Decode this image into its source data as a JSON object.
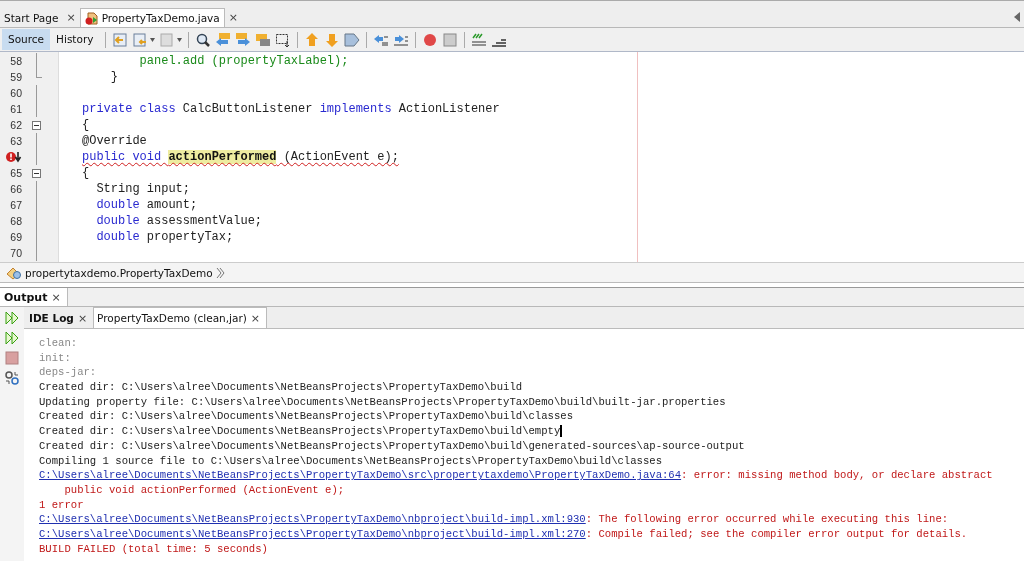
{
  "editor_tabs": [
    {
      "label": "Start Page",
      "close": "×",
      "selected": false
    },
    {
      "label": "PropertyTaxDemo.java",
      "close": "×",
      "selected": true
    }
  ],
  "view_tabs": [
    {
      "label": "Source",
      "selected": true
    },
    {
      "label": "History",
      "selected": false
    }
  ],
  "code_lines": [
    {
      "number": "58",
      "foldable": false,
      "fold_end": false,
      "segments": [
        {
          "text": "        panel.add (propertyTaxLabel);",
          "kind": "field"
        }
      ]
    },
    {
      "number": "59",
      "foldable": false,
      "fold_end": true,
      "segments": [
        {
          "text": "    }",
          "kind": "plain"
        }
      ]
    },
    {
      "number": "60",
      "foldable": false,
      "fold_end": false
    },
    {
      "number": "61",
      "foldable": false,
      "fold_end": false,
      "segments": [
        {
          "text": "private class",
          "kind": "keyword"
        },
        {
          "text": " CalcButtonListener ",
          "kind": "plain"
        },
        {
          "text": "implements",
          "kind": "keyword"
        },
        {
          "text": " ActionListener",
          "kind": "plain"
        }
      ]
    },
    {
      "number": "62",
      "foldable": true,
      "fold_end": false,
      "segments": [
        {
          "text": "{",
          "kind": "plain"
        }
      ]
    },
    {
      "number": "63",
      "foldable": false,
      "fold_end": false,
      "segments": [
        {
          "text": "@Override",
          "kind": "plain"
        }
      ]
    },
    {
      "foldable": false,
      "fold_end": false,
      "error": true,
      "squiggle": true,
      "segments": [
        {
          "text": "public void ",
          "kind": "keyword"
        },
        {
          "text": "actionPerformed",
          "kind": "highlight"
        },
        {
          "text": " (ActionEvent e);",
          "kind": "plain"
        }
      ]
    },
    {
      "number": "65",
      "foldable": true,
      "fold_end": false,
      "segments": [
        {
          "text": "{",
          "kind": "plain"
        }
      ]
    },
    {
      "number": "66",
      "foldable": false,
      "fold_end": false,
      "segments": [
        {
          "text": "  String input;",
          "kind": "plain"
        }
      ]
    },
    {
      "number": "67",
      "foldable": false,
      "fold_end": false,
      "segments": [
        {
          "text": "  double",
          "kind": "keyword"
        },
        {
          "text": " amount;",
          "kind": "plain"
        }
      ]
    },
    {
      "number": "68",
      "foldable": false,
      "fold_end": false,
      "segments": [
        {
          "text": "  double",
          "kind": "keyword"
        },
        {
          "text": " assessmentValue;",
          "kind": "plain"
        }
      ]
    },
    {
      "number": "69",
      "foldable": false,
      "fold_end": false,
      "segments": [
        {
          "text": "  double",
          "kind": "keyword"
        },
        {
          "text": " propertyTax;",
          "kind": "plain"
        }
      ]
    },
    {
      "number": "70",
      "foldable": false,
      "fold_end": false
    }
  ],
  "breadcrumb": "propertytaxdemo.PropertyTaxDemo",
  "output_panel": {
    "title": "Output",
    "close": "×",
    "tabs": [
      {
        "label": "IDE Log",
        "close": "×",
        "selected": false
      },
      {
        "label": "PropertyTaxDemo (clean,jar)",
        "close": "×",
        "selected": true
      }
    ],
    "lines": [
      {
        "segments": [
          {
            "text": "clean:",
            "kind": "grey"
          }
        ]
      },
      {
        "segments": [
          {
            "text": "init:",
            "kind": "grey"
          }
        ]
      },
      {
        "segments": [
          {
            "text": "deps-jar:",
            "kind": "grey"
          }
        ]
      },
      {
        "segments": [
          {
            "text": "Created dir: C:\\Users\\alree\\Documents\\NetBeansProjects\\PropertyTaxDemo\\build",
            "kind": "plain"
          }
        ]
      },
      {
        "segments": [
          {
            "text": "Updating property file: C:\\Users\\alree\\Documents\\NetBeansProjects\\PropertyTaxDemo\\build\\built-jar.properties",
            "kind": "plain"
          }
        ]
      },
      {
        "segments": [
          {
            "text": "Created dir: C:\\Users\\alree\\Documents\\NetBeansProjects\\PropertyTaxDemo\\build\\classes",
            "kind": "plain"
          }
        ]
      },
      {
        "caret": true,
        "segments": [
          {
            "text": "Created dir: C:\\Users\\alree\\Documents\\NetBeansProjects\\PropertyTaxDemo\\build\\empty",
            "kind": "plain"
          }
        ]
      },
      {
        "segments": [
          {
            "text": "Created dir: C:\\Users\\alree\\Documents\\NetBeansProjects\\PropertyTaxDemo\\build\\generated-sources\\ap-source-output",
            "kind": "plain"
          }
        ]
      },
      {
        "segments": [
          {
            "text": "Compiling 1 source file to C:\\Users\\alree\\Documents\\NetBeansProjects\\PropertyTaxDemo\\build\\classes",
            "kind": "plain"
          }
        ]
      },
      {
        "segments": [
          {
            "text": "C:\\Users\\alree\\Documents\\NetBeansProjects\\PropertyTaxDemo\\src\\propertytaxdemo\\PropertyTaxDemo.java:64",
            "kind": "link"
          },
          {
            "text": ": error: missing method body, or declare abstract",
            "kind": "error"
          }
        ]
      },
      {
        "segments": [
          {
            "text": "    public void actionPerformed (ActionEvent e);",
            "kind": "error"
          }
        ]
      },
      {
        "segments": [
          {
            "text": "1 error",
            "kind": "error"
          }
        ]
      },
      {
        "segments": [
          {
            "text": "C:\\Users\\alree\\Documents\\NetBeansProjects\\PropertyTaxDemo\\nbproject\\build-impl.xml:930",
            "kind": "link"
          },
          {
            "text": ": The following error occurred while executing this line:",
            "kind": "error"
          }
        ]
      },
      {
        "segments": [
          {
            "text": "C:\\Users\\alree\\Documents\\NetBeansProjects\\PropertyTaxDemo\\nbproject\\build-impl.xml:270",
            "kind": "link"
          },
          {
            "text": ": Compile failed; see the compiler error output for details.",
            "kind": "error"
          }
        ]
      },
      {
        "segments": [
          {
            "text": "BUILD FAILED (total time: 5 seconds)",
            "kind": "error"
          }
        ]
      }
    ]
  }
}
